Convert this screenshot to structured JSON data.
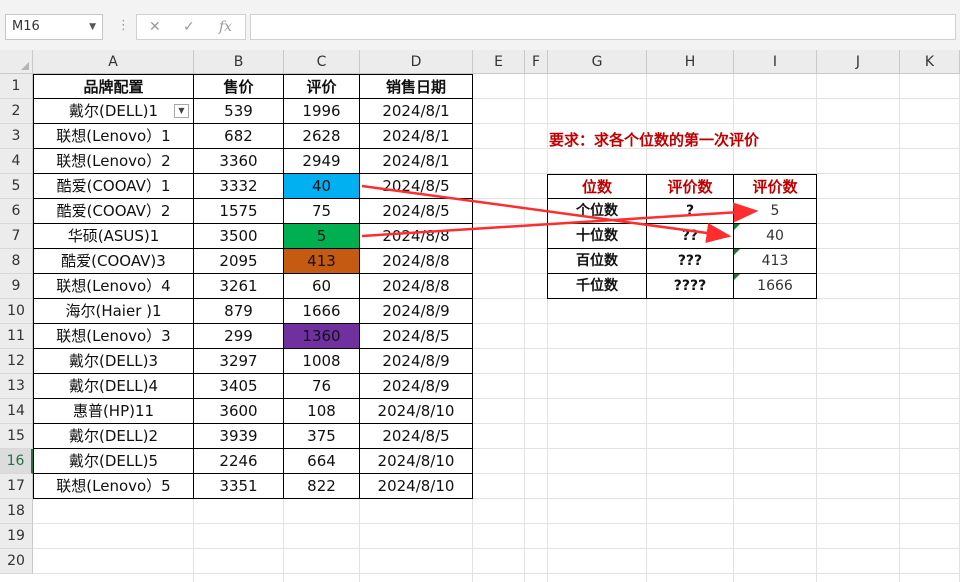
{
  "name_box": "M16",
  "formula_buttons": {
    "cancel_icon": "✕",
    "enter_icon": "✓",
    "fx_label": "fx"
  },
  "columns": [
    "A",
    "B",
    "C",
    "D",
    "E",
    "F",
    "G",
    "H",
    "I",
    "J",
    "K"
  ],
  "rows": [
    "1",
    "2",
    "3",
    "4",
    "5",
    "6",
    "7",
    "8",
    "9",
    "10",
    "11",
    "12",
    "13",
    "14",
    "15",
    "16",
    "17",
    "18",
    "19",
    "20"
  ],
  "active_row": "16",
  "table": {
    "headers": [
      "品牌配置",
      "售价",
      "评价",
      "销售日期"
    ],
    "rows": [
      [
        "戴尔(DELL)1",
        "539",
        "1996",
        "2024/8/1"
      ],
      [
        "联想(Lenovo）1",
        "682",
        "2628",
        "2024/8/1"
      ],
      [
        "联想(Lenovo）2",
        "3360",
        "2949",
        "2024/8/1"
      ],
      [
        "酷爱(COOAV）1",
        "3332",
        "40",
        "2024/8/5"
      ],
      [
        "酷爱(COOAV）2",
        "1575",
        "75",
        "2024/8/5"
      ],
      [
        "华硕(ASUS)1",
        "3500",
        "5",
        "2024/8/8"
      ],
      [
        "酷爱(COOAV)3",
        "2095",
        "413",
        "2024/8/8"
      ],
      [
        "联想(Lenovo）4",
        "3261",
        "60",
        "2024/8/8"
      ],
      [
        "海尔(Haier )1",
        "879",
        "1666",
        "2024/8/9"
      ],
      [
        "联想(Lenovo）3",
        "299",
        "1360",
        "2024/8/5"
      ],
      [
        "戴尔(DELL)3",
        "3297",
        "1008",
        "2024/8/9"
      ],
      [
        "戴尔(DELL)4",
        "3405",
        "76",
        "2024/8/9"
      ],
      [
        "惠普(HP)11",
        "3600",
        "108",
        "2024/8/10"
      ],
      [
        "戴尔(DELL)2",
        "3939",
        "375",
        "2024/8/5"
      ],
      [
        "戴尔(DELL)5",
        "2246",
        "664",
        "2024/8/10"
      ],
      [
        "联想(Lenovo）5",
        "3351",
        "822",
        "2024/8/10"
      ]
    ],
    "highlights": [
      {
        "row": 3,
        "color": "#00b0f0"
      },
      {
        "row": 5,
        "color": "#00b050"
      },
      {
        "row": 6,
        "color": "#c55a11"
      },
      {
        "row": 9,
        "color": "#7030a0"
      }
    ]
  },
  "requirement": "要求：求各个位数的第一次评价",
  "result_table": {
    "headers": [
      "位数",
      "评价数",
      "评价数"
    ],
    "rows": [
      [
        "个位数",
        "?",
        "5"
      ],
      [
        "十位数",
        "??",
        "40"
      ],
      [
        "百位数",
        "???",
        "413"
      ],
      [
        "千位数",
        "????",
        "1666"
      ]
    ]
  },
  "colors": {
    "header_red": "#c00000",
    "arrow_red": "#ff2d2d",
    "excel_green": "#217346"
  }
}
